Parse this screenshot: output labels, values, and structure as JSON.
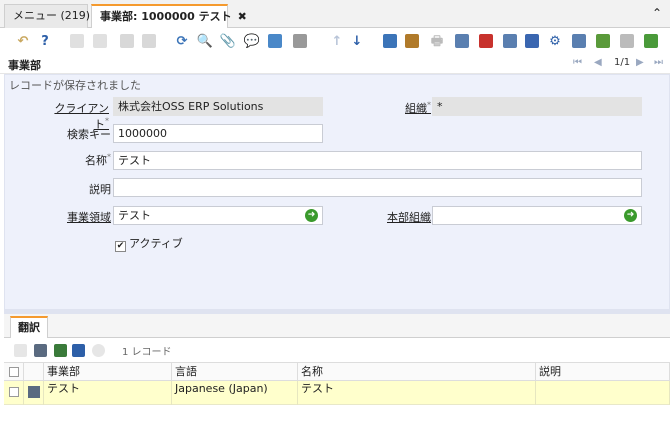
{
  "tabs": {
    "menu": {
      "label": "メニュー (219)"
    },
    "active": {
      "label": "事業部: 1000000 テスト",
      "close": "✖"
    },
    "collapse": "⌃"
  },
  "toolbar": {
    "icons": [
      {
        "name": "undo-icon",
        "glyph": "↶",
        "color": "#c9a860"
      },
      {
        "name": "help-icon",
        "glyph": "?",
        "color": "#2d5fa8"
      },
      {
        "name": "new-record-icon",
        "glyph": "",
        "color": "#e0e0e0"
      },
      {
        "name": "copy-record-icon",
        "glyph": "",
        "color": "#e0e0e0"
      },
      {
        "name": "save-icon",
        "glyph": "",
        "color": "#d8d8d8"
      },
      {
        "name": "save-new-icon",
        "glyph": "",
        "color": "#d8d8d8"
      },
      {
        "name": "refresh-icon",
        "glyph": "⟳",
        "color": "#3b74b8"
      },
      {
        "name": "find-icon",
        "glyph": "🔍",
        "color": "#3b74b8"
      },
      {
        "name": "attachment-icon",
        "glyph": "📎",
        "color": "#5a7fb0"
      },
      {
        "name": "chat-icon",
        "glyph": "💬",
        "color": "#777"
      },
      {
        "name": "form-view-icon",
        "glyph": "",
        "color": "#4a88c8"
      },
      {
        "name": "grid-toggle-icon",
        "glyph": "",
        "color": "#999"
      },
      {
        "name": "previous-record-icon",
        "glyph": "↑",
        "color": "#b8c4d8"
      },
      {
        "name": "next-record-icon",
        "glyph": "↓",
        "color": "#2d5fa8"
      },
      {
        "name": "report-icon",
        "glyph": "",
        "color": "#3b74b8"
      },
      {
        "name": "archive-icon",
        "glyph": "",
        "color": "#b07a2a"
      },
      {
        "name": "print-icon",
        "glyph": "🖶",
        "color": "#bbb"
      },
      {
        "name": "zoom-across-icon",
        "glyph": "",
        "color": "#5a7fb0"
      },
      {
        "name": "request-icon",
        "glyph": "",
        "color": "#c8322d"
      },
      {
        "name": "workflow-icon",
        "glyph": "",
        "color": "#5a7fb0"
      },
      {
        "name": "product-info-icon",
        "glyph": "",
        "color": "#3a66b0"
      },
      {
        "name": "settings-icon",
        "glyph": "⚙",
        "color": "#2d5fa8"
      },
      {
        "name": "export-icon",
        "glyph": "",
        "color": "#5a7fb0"
      },
      {
        "name": "import-icon",
        "glyph": "",
        "color": "#5a9a3a"
      },
      {
        "name": "delete-icon",
        "glyph": "",
        "color": "#bbb"
      },
      {
        "name": "customize-icon",
        "glyph": "",
        "color": "#4a9a3a"
      }
    ]
  },
  "header": {
    "title": "事業部",
    "nav_first": "⏮",
    "nav_prev": "◀",
    "page": "1/1",
    "nav_next": "▶",
    "nav_last": "⏭"
  },
  "form": {
    "status": "レコードが保存されました",
    "client_label": "クライアント",
    "client_value": "株式会社OSS ERP Solutions",
    "org_label": "組織",
    "org_value": "*",
    "searchkey_label": "検索キー",
    "searchkey_value": "1000000",
    "name_label": "名称",
    "name_value": "テスト",
    "description_label": "説明",
    "description_value": "",
    "area_label": "事業領域",
    "area_value": "テスト",
    "parent_org_label": "本部組織",
    "parent_org_value": "",
    "active_label": "アクティブ",
    "active_checked": "✔",
    "required_mark": "*"
  },
  "detail": {
    "tab_label": "翻訳",
    "record_count": "1 レコード",
    "columns": [
      "事業部",
      "言語",
      "名称",
      "説明"
    ],
    "rows": [
      {
        "bu": "テスト",
        "language": "Japanese (Japan)",
        "name": "テスト",
        "description": ""
      }
    ]
  }
}
